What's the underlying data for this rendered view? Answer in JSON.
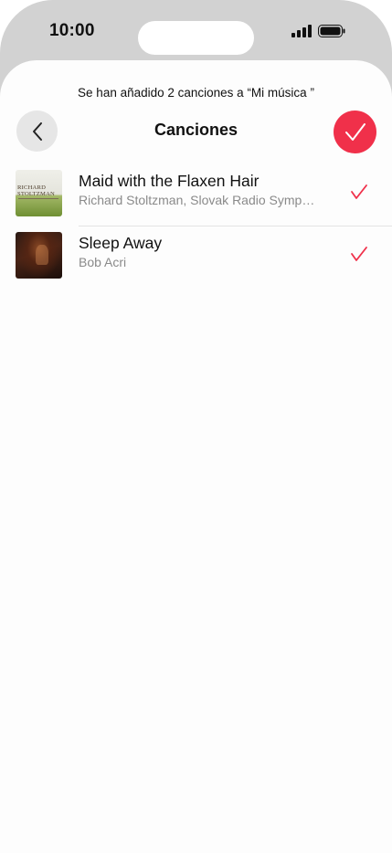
{
  "status_bar": {
    "time": "10:00"
  },
  "sheet": {
    "toast": "Se han añadido 2 canciones a “Mi música ”",
    "title": "Canciones",
    "back_icon": "chevron-left-icon",
    "done_icon": "checkmark-icon"
  },
  "songs": [
    {
      "title": "Maid with the Flaxen Hair",
      "artist": "Richard Stoltzman, Slovak Radio Symphony Orchestra",
      "artwork_text": "RICHARD STOLTZMAN",
      "selected": true
    },
    {
      "title": "Sleep Away",
      "artist": "Bob Acri",
      "selected": true
    }
  ],
  "colors": {
    "accent": "#f0304a",
    "frame": "#d2d2d2",
    "secondary_text": "#8a8a8a"
  }
}
